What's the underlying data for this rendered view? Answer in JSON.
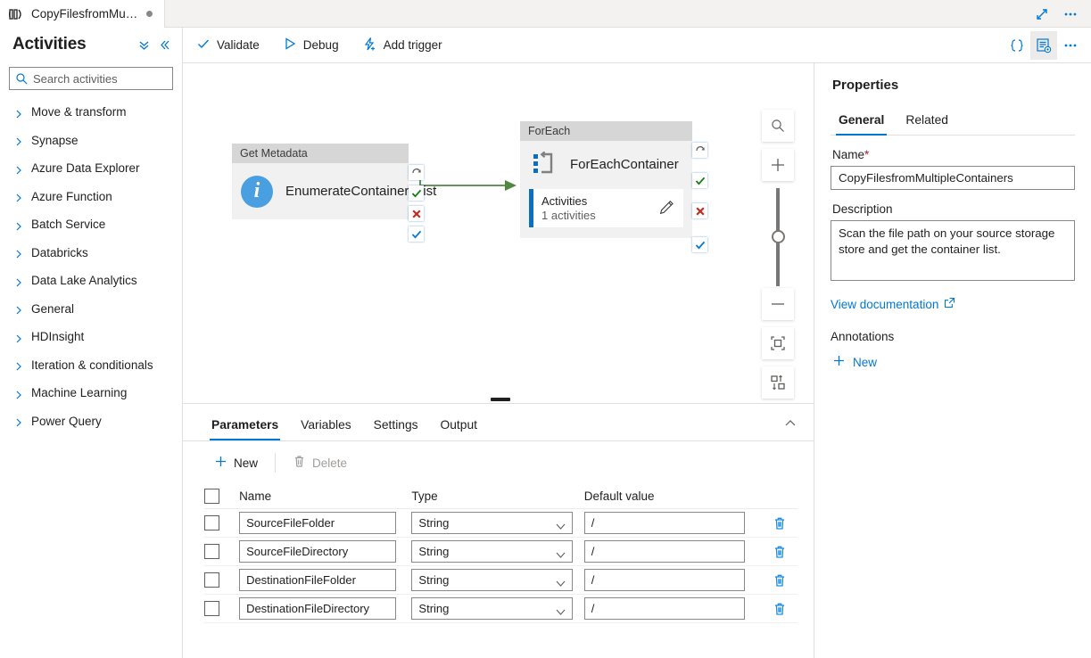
{
  "tab": {
    "label": "CopyFilesfromMul...",
    "icon": "pipeline-icon",
    "dirty_dot": true
  },
  "tabstrip_actions": [
    {
      "name": "expand-icon",
      "glyph": "↗"
    },
    {
      "name": "more-options-icon",
      "glyph": "···"
    }
  ],
  "sidebar": {
    "title": "Activities",
    "collapse_all_icon": "chevron-double-down-icon",
    "collapse_panel_icon": "chevron-double-left-icon",
    "search": {
      "placeholder": "Search activities",
      "value": ""
    },
    "items": [
      {
        "label": "Move & transform"
      },
      {
        "label": "Synapse"
      },
      {
        "label": "Azure Data Explorer"
      },
      {
        "label": "Azure Function"
      },
      {
        "label": "Batch Service"
      },
      {
        "label": "Databricks"
      },
      {
        "label": "Data Lake Analytics"
      },
      {
        "label": "General"
      },
      {
        "label": "HDInsight"
      },
      {
        "label": "Iteration & conditionals"
      },
      {
        "label": "Machine Learning"
      },
      {
        "label": "Power Query"
      }
    ]
  },
  "commandbar": {
    "validate": "Validate",
    "debug": "Debug",
    "add_trigger": "Add trigger",
    "code_icon": "{}",
    "properties_icon": "properties-panel-icon",
    "more_icon": "···"
  },
  "canvas": {
    "nodes": [
      {
        "type_label": "Get Metadata",
        "name": "EnumerateContainersList",
        "icon": "info-circle-icon"
      },
      {
        "type_label": "ForEach",
        "name": "ForEachContainer",
        "icon": "foreach-icon",
        "activities_label": "Activities",
        "activities_count": "1 activities",
        "edit_icon": "pencil-icon"
      }
    ],
    "chips": [
      {
        "name": "retry-icon",
        "glyph": "↷"
      },
      {
        "name": "success-check-icon",
        "glyph": "✔"
      },
      {
        "name": "failure-x-icon",
        "glyph": "✖"
      },
      {
        "name": "completion-check-icon",
        "glyph": "✔"
      }
    ],
    "zoom_tools": [
      {
        "name": "zoom-search-icon"
      },
      {
        "name": "zoom-in-icon"
      },
      {
        "name": "zoom-out-icon"
      },
      {
        "name": "fit-to-screen-icon"
      },
      {
        "name": "auto-align-icon"
      }
    ]
  },
  "bottom_panel": {
    "tabs": [
      {
        "label": "Parameters",
        "active": true
      },
      {
        "label": "Variables",
        "active": false
      },
      {
        "label": "Settings",
        "active": false
      },
      {
        "label": "Output",
        "active": false
      }
    ],
    "collapse_icon": "chevron-up-icon",
    "toolbar": {
      "new_label": "New",
      "delete_label": "Delete",
      "delete_disabled": true
    },
    "table": {
      "columns": [
        "Name",
        "Type",
        "Default value"
      ],
      "rows": [
        {
          "name": "SourceFileFolder",
          "type": "String",
          "default": "/"
        },
        {
          "name": "SourceFileDirectory",
          "type": "String",
          "default": "/"
        },
        {
          "name": "DestinationFileFolder",
          "type": "String",
          "default": "/"
        },
        {
          "name": "DestinationFileDirectory",
          "type": "String",
          "default": "/"
        }
      ],
      "row_delete_icon": "trash-icon"
    }
  },
  "properties": {
    "title": "Properties",
    "tabs": [
      {
        "label": "General",
        "active": true
      },
      {
        "label": "Related",
        "active": false
      }
    ],
    "name_label": "Name",
    "name_required_mark": "*",
    "name_value": "CopyFilesfromMultipleContainers",
    "description_label": "Description",
    "description_value": "Scan the file path on your source storage store and get the container list.",
    "view_documentation": "View documentation",
    "external_link_icon": "external-link-icon",
    "annotations_label": "Annotations",
    "annotations_new": "New"
  },
  "colors": {
    "accent": "#0078d4",
    "link": "#0078d4",
    "node_header": "#d6d6d6",
    "node_body": "#f1f1f1",
    "connector_green": "#4e8a3e",
    "error_red": "#c4281c",
    "info_blue": "#4a9fe0"
  }
}
